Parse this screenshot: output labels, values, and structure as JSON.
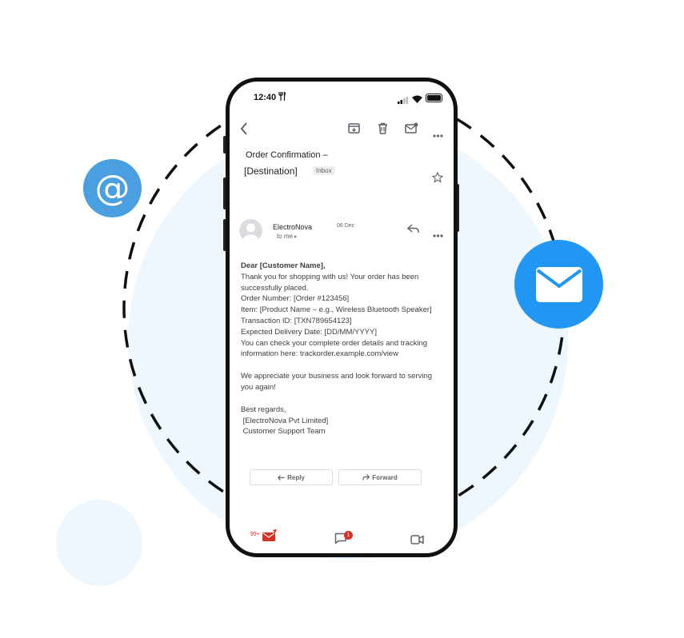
{
  "status_bar": {
    "time": "12:40",
    "time_icon": "utensils-icon"
  },
  "toolbar": {
    "back_icon": "chevron-left-icon",
    "archive_icon": "archive-icon",
    "delete_icon": "trash-icon",
    "mark_unread_icon": "mail-dot-icon",
    "more_icon": "more-horizontal-icon"
  },
  "email": {
    "subject_line1": "Order Confirmation –",
    "subject_line2": "[Destination]",
    "label": "Inbox",
    "sender": "ElectroNova",
    "date": "06 Dec",
    "recipient": "to me",
    "body": {
      "greeting": "Dear [Customer Name],",
      "lines": [
        "Thank you for shopping with us! Your order has been successfully placed.",
        "Order Number: [Order #123456]",
        "Item: [Product Name – e.g., Wireless Bluetooth Speaker]",
        "Transaction ID: [TXN789654123]",
        "Expected Delivery Date: [DD/MM/YYYY]",
        "You can check your complete order details and tracking information here: trackorder.example.com/view"
      ],
      "closing_paragraph": "We appreciate your business and look forward to serving you again!",
      "sign_off": "Best regards,",
      "company": " [ElectroNova Pvt Limited]",
      "team": " Customer Support Team"
    }
  },
  "actions": {
    "reply": "Reply",
    "forward": "Forward"
  },
  "bottom_nav": {
    "mail_count": "99+",
    "chat_badge": "1"
  },
  "colors": {
    "accent": "#2196f3",
    "at_badge": "#4a9fe0",
    "background_circle": "#eef7fe",
    "gmail_red": "#d93025"
  }
}
